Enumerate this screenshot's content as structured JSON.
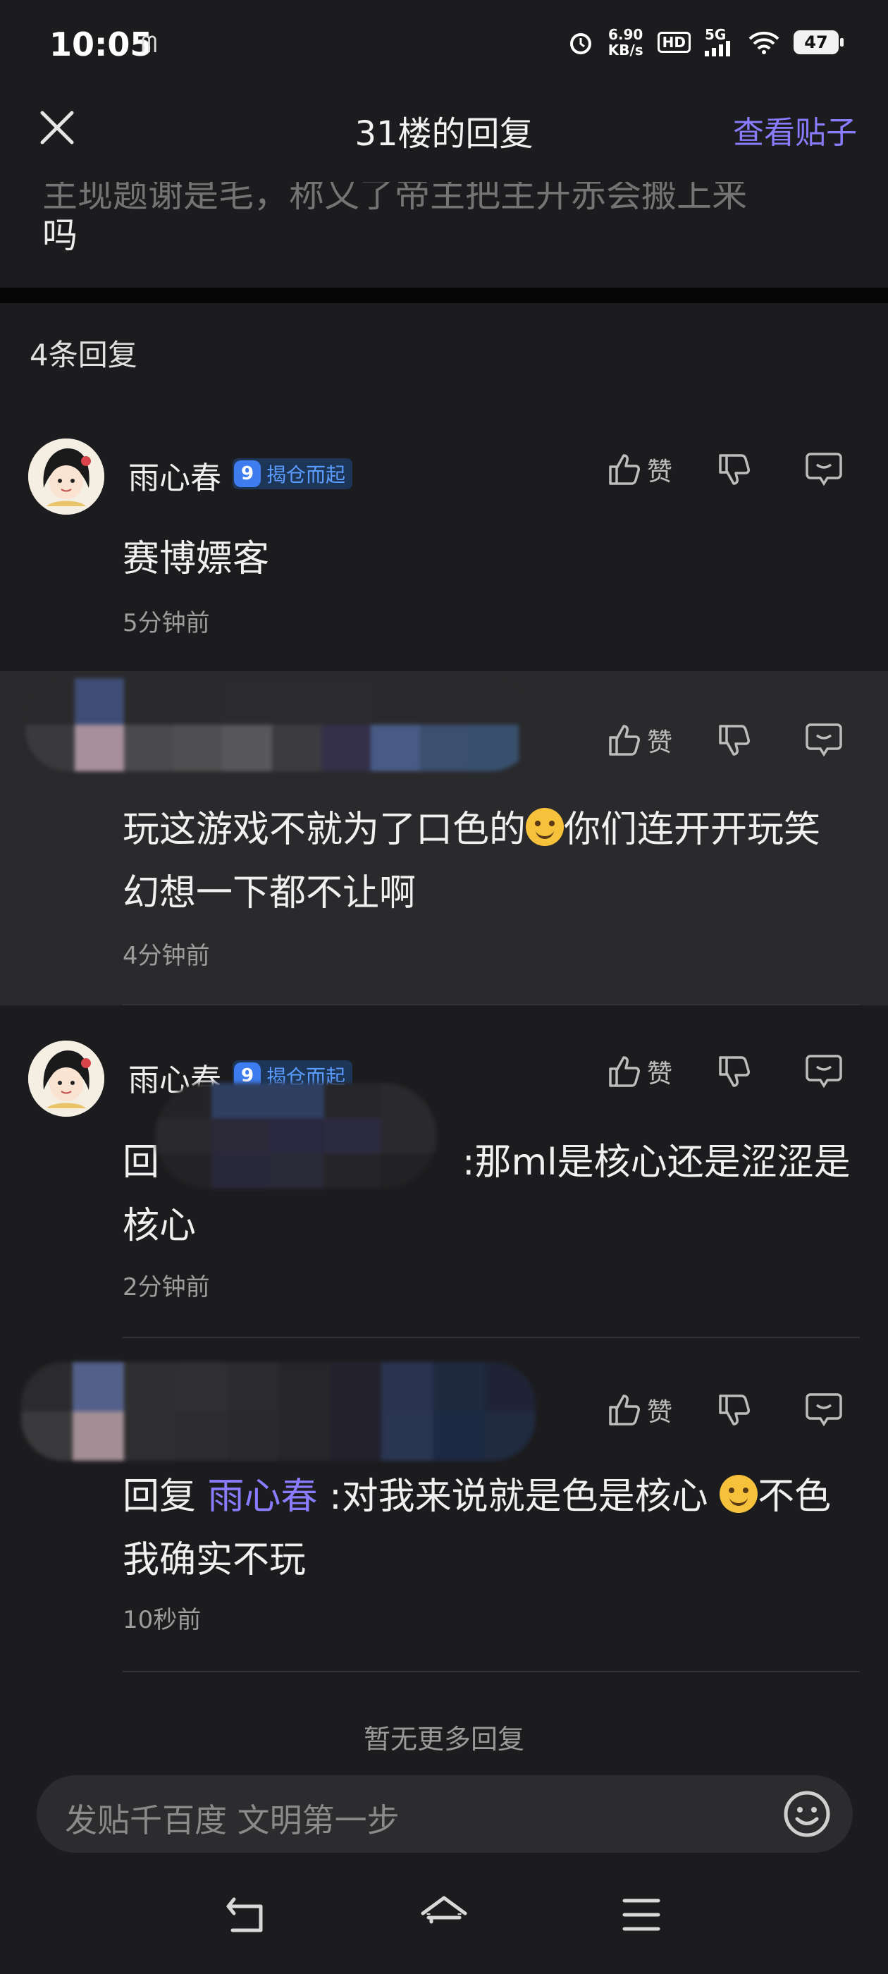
{
  "status_bar": {
    "time": "10:05",
    "network_speed_value": "6.90",
    "network_speed_unit": "KB/s",
    "hd": "HD",
    "signal": "5G",
    "battery": "47"
  },
  "header": {
    "title": "31楼的回复",
    "view_post": "查看贴子"
  },
  "quoted_post": {
    "line_partial": "主现题谢是毛，称又了帝主把主开赤会搬上来",
    "line_last": "吗"
  },
  "reply_count": "4条回复",
  "actions": {
    "like": "赞"
  },
  "replies": [
    {
      "username": "雨心春",
      "level": "9",
      "badge": "揭仓而起",
      "text": "赛博嫖客",
      "time": "5分钟前"
    },
    {
      "username": "",
      "text_before_emoji": "玩这游戏不就为了口色的",
      "text_after_emoji": "你们连开开玩笑幻想一下都不让啊",
      "time": "4分钟前"
    },
    {
      "username": "雨心春",
      "level": "9",
      "badge": "揭仓而起",
      "reply_prefix": "回",
      "text_after_mention": ":那ml是核心还是涩涩是核心",
      "time": "2分钟前"
    },
    {
      "username": "",
      "reply_prefix": "回复",
      "mention": "雨心春",
      "text_before_emoji": ":对我来说就是色是核心",
      "text_after_emoji": "不色我确实不玩",
      "time": "10秒前"
    }
  ],
  "no_more": "暂无更多回复",
  "composer": {
    "placeholder": "发贴千百度 文明第一步"
  },
  "icons": {
    "close": "close-icon",
    "like": "thumbs-up-icon",
    "dislike": "thumbs-down-icon",
    "comment": "comment-icon",
    "emoji": "emoji-icon",
    "back": "back-icon",
    "home": "home-icon",
    "menu": "menu-icon"
  }
}
